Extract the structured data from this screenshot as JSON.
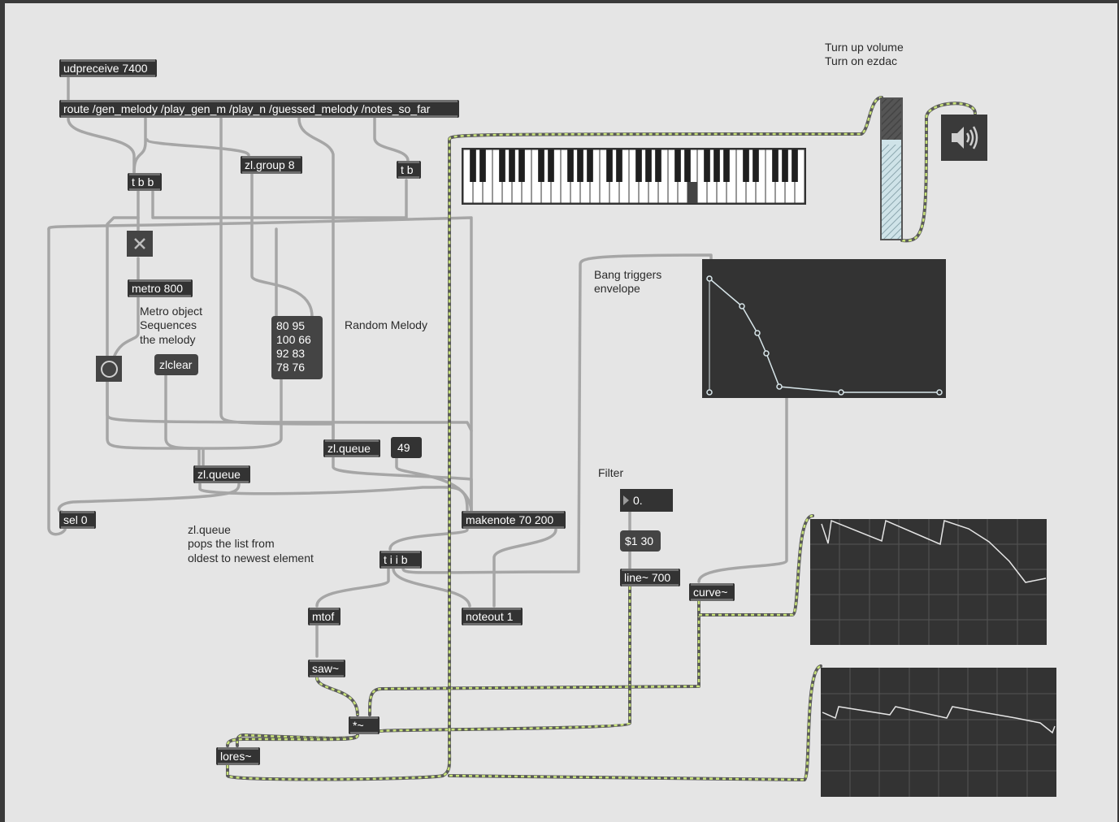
{
  "objects": {
    "udpreceive": "udpreceive 7400",
    "route": "route /gen_melody /play_gen_m /play_n /guessed_melody /notes_so_far",
    "tbb": "t b b",
    "zlgroup": "zl.group 8",
    "tb": "t b",
    "metro": "metro 800",
    "zlclear": "zlclear",
    "zlqueue_left": "zl.queue",
    "zlqueue_right": "zl.queue",
    "number_49": "49",
    "sel0": "sel 0",
    "makenote": "makenote 70 200",
    "tiib": "t i i b",
    "mtof": "mtof",
    "noteout": "noteout 1",
    "saw": "saw~",
    "times": "*~",
    "lores": "lores~",
    "flonum": "0.",
    "msg_130": "$1 30",
    "line": "line~ 700",
    "curve": "curve~"
  },
  "melody_list": {
    "lines": [
      "80 95",
      "100 66",
      "92 83",
      "78 76"
    ]
  },
  "comments": {
    "turn_up_1": "Turn up volume",
    "turn_up_2": "Turn on ezdac",
    "random_melody": "Random Melody",
    "bang_triggers_1": "Bang triggers",
    "bang_triggers_2": "envelope",
    "metro_1": "Metro object",
    "metro_2": "Sequences",
    "metro_3": "the melody",
    "filter": "Filter",
    "zlqueue_1": "zl.queue",
    "zlqueue_2": "pops the list from",
    "zlqueue_3": "oldest to newest element"
  },
  "icons": {
    "toggle": "x-toggle-icon",
    "bang": "bang-circle-icon",
    "ezdac": "speaker-icon"
  },
  "colors": {
    "object_bg": "#333333",
    "signal_patchcord": "#c9e37a",
    "patch_bg": "#e5e5e5"
  }
}
